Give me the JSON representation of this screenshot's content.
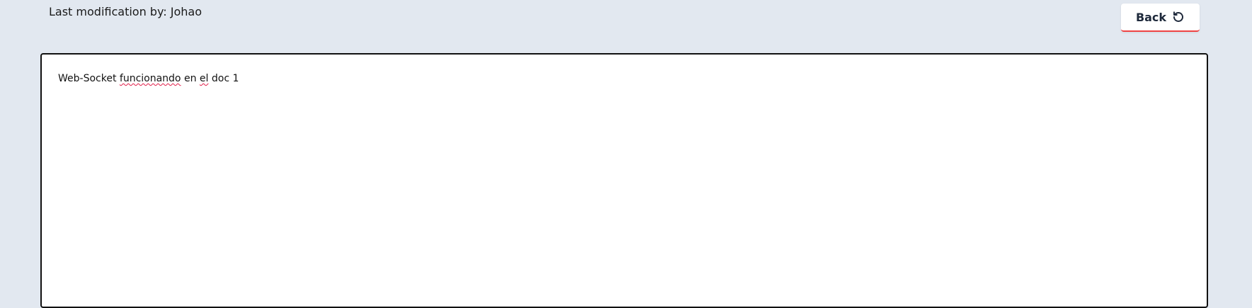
{
  "header": {
    "last_modification_prefix": "Last modification by: ",
    "last_modification_user": "Johao"
  },
  "toolbar": {
    "back_label": "Back",
    "back_icon": "undo-icon"
  },
  "editor": {
    "words": [
      "Web-Socket",
      "funcionando",
      "en",
      "el",
      "doc",
      "1"
    ],
    "misspelled_words": [
      "funcionando",
      "el"
    ]
  },
  "colors": {
    "background": "#e2e8f0",
    "editor_background": "#ffffff",
    "button_accent": "#ef4444",
    "spellcheck_underline": "#e11d48"
  }
}
